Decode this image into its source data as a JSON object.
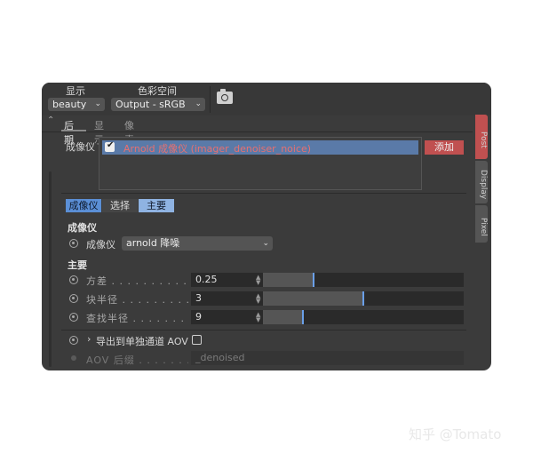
{
  "toolbar": {
    "display_header": "显示",
    "display_value": "beauty",
    "colorspace_header": "色彩空间",
    "colorspace_value": "Output - sRGB",
    "camera_icon": "camera-icon"
  },
  "tabs": [
    "后期",
    "显示",
    "像素"
  ],
  "right_tabs": [
    {
      "label": "Post",
      "color": "#c05050"
    },
    {
      "label": "Display",
      "color": "#555555"
    },
    {
      "label": "Pixel",
      "color": "#555555"
    }
  ],
  "imager_panel": {
    "label": "成像仪",
    "item": "Arnold 成像仪 (imager_denoiser_noice)",
    "add_label": "添加"
  },
  "subtabs": [
    "成像仪",
    "选择",
    "主要"
  ],
  "sections": {
    "imager_title": "成像仪",
    "imager_field_label": "成像仪",
    "imager_dropdown": "arnold 降噪",
    "main_title": "主要"
  },
  "params": [
    {
      "label": "方差",
      "value": "0.25",
      "fill": 0.25
    },
    {
      "label": "块半径",
      "value": "3",
      "fill": 0.5
    },
    {
      "label": "查找半径",
      "value": "9",
      "fill": 0.2
    }
  ],
  "aov": {
    "export_label": "导出到单独通道 AOV",
    "suffix_label": "AOV 后缀",
    "suffix_value": "_denoised"
  },
  "watermark": "知乎 @Tomato",
  "colors": {
    "accent": "#5b8fd6",
    "add_button": "#c05050",
    "highlight_text": "#e87070"
  }
}
